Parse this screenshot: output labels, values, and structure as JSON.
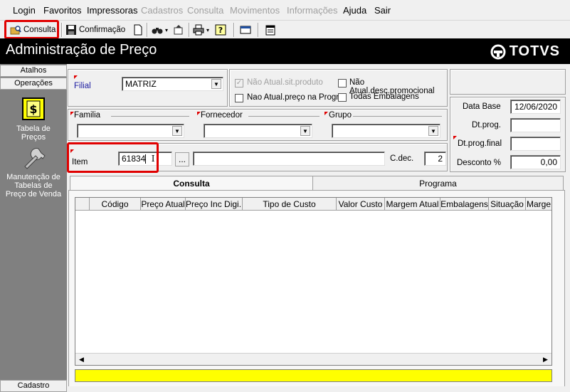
{
  "menu": [
    "Login",
    "Favoritos",
    "Impressoras",
    "Cadastros",
    "Consulta",
    "Movimentos",
    "Informações",
    "Ajuda",
    "Sair"
  ],
  "toolbar": {
    "consulta_label": "Consulta",
    "confirmacao_label": "Confirmação"
  },
  "header": {
    "title": "Administração de Preço",
    "logo": "TOTVS"
  },
  "nav": {
    "atalhos": "Atalhos",
    "operacoes": "Operações",
    "items": [
      {
        "label": "Tabela de Preços",
        "icon": "price-table-icon"
      },
      {
        "label": "Manutenção de Tabelas de Preço de Venda",
        "icon": "wrench-icon"
      }
    ],
    "cadastro": "Cadastro"
  },
  "filters": {
    "filial_label": "Filial",
    "filial_value": "MATRIZ",
    "nao_atual_sit_produto": "Não Atual.sit.produto",
    "nao_atual_preco_prog": "Nao Atual.preço na Progr.",
    "nao_atual_desc_promocional": "Não Atual.desc.promocional",
    "todas_embalagens": "Todas Embalagens",
    "familia_label": "Familia",
    "fornecedor_label": "Fornecedor",
    "grupo_label": "Grupo",
    "item_label": "Item",
    "item_value": "61834",
    "browse_label": "...",
    "cdec_label": "C.dec.",
    "cdec_value": "2"
  },
  "side": {
    "data_base_label": "Data Base",
    "data_base_value": "12/06/2020",
    "dt_prog_label": "Dt.prog.",
    "dt_prog_final_label": "Dt.prog.final",
    "desconto_label": "Desconto %",
    "desconto_value": "0,00"
  },
  "tabs": [
    "Consulta",
    "Programa"
  ],
  "grid": {
    "columns": [
      "",
      "Código",
      "Preço Atual",
      "Preço Inc Digi...",
      "Tipo de Custo",
      "Valor Custo",
      "Margem Atual",
      "Embalagens",
      "Situação",
      "Marge"
    ]
  },
  "colors": {
    "highlight": "#e00000",
    "status_bar": "#ffff00",
    "nav_bg": "#808080"
  }
}
